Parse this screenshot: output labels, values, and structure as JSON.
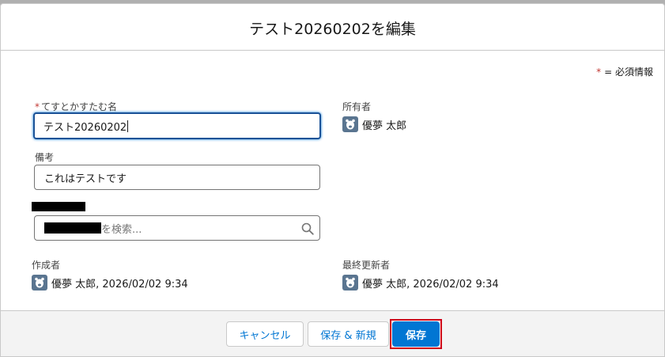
{
  "modal": {
    "title": "テスト20260202を編集"
  },
  "legend": {
    "required_marker": "*",
    "text": "= 必須情報"
  },
  "fields": {
    "name": {
      "required_marker": "*",
      "label": "てすとかすたむ名",
      "value": "テスト20260202"
    },
    "note": {
      "label": "備考",
      "value": "これはテストです"
    },
    "lookup": {
      "placeholder_suffix": "を検索..."
    },
    "owner": {
      "label": "所有者",
      "value": "優夢 太郎"
    },
    "created_by": {
      "label": "作成者",
      "value": "優夢 太郎, 2026/02/02 9:34"
    },
    "last_modified_by": {
      "label": "最終更新者",
      "value": "優夢 太郎, 2026/02/02 9:34"
    }
  },
  "footer": {
    "cancel_label": "キャンセル",
    "save_new_label": "保存 & 新規",
    "save_label": "保存"
  },
  "colors": {
    "brand": "#0176d3",
    "required": "#c23934",
    "highlight": "#d0021b",
    "avatar": "#5a7590"
  }
}
